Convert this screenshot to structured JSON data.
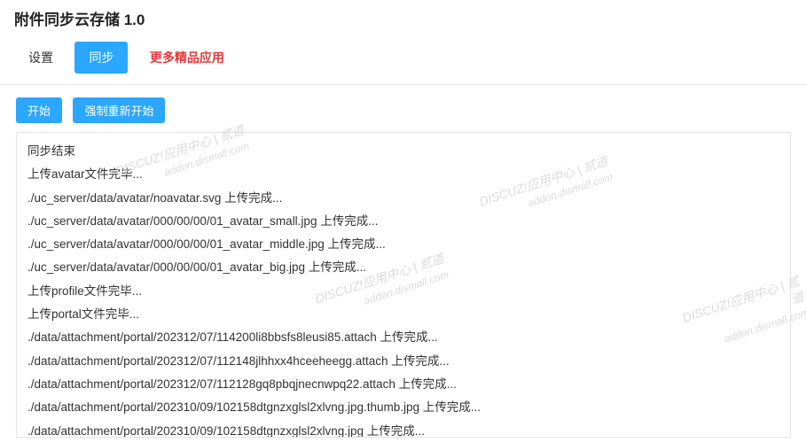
{
  "header": {
    "title": "附件同步云存储 1.0"
  },
  "tabs": {
    "settings": "设置",
    "sync": "同步",
    "more_apps": "更多精品应用"
  },
  "actions": {
    "start": "开始",
    "force_restart": "强制重新开始"
  },
  "log": [
    "同步结束",
    "上传avatar文件完毕...",
    "./uc_server/data/avatar/noavatar.svg 上传完成...",
    "./uc_server/data/avatar/000/00/00/01_avatar_small.jpg 上传完成...",
    "./uc_server/data/avatar/000/00/00/01_avatar_middle.jpg 上传完成...",
    "./uc_server/data/avatar/000/00/00/01_avatar_big.jpg 上传完成...",
    "上传profile文件完毕...",
    "上传portal文件完毕...",
    "./data/attachment/portal/202312/07/114200li8bbsfs8leusi85.attach 上传完成...",
    "./data/attachment/portal/202312/07/112148jlhhxx4hceeheegg.attach 上传完成...",
    "./data/attachment/portal/202312/07/112128gq8pbqjnecnwpq22.attach 上传完成...",
    "./data/attachment/portal/202310/09/102158dtgnzxglsl2xlvng.jpg.thumb.jpg 上传完成...",
    "./data/attachment/portal/202310/09/102158dtgnzxglsl2xlvng.jpg 上传完成..."
  ],
  "watermark": {
    "brand": "DISCUZ!应用中心 | 贰道",
    "url": "addon.dismall.com"
  }
}
